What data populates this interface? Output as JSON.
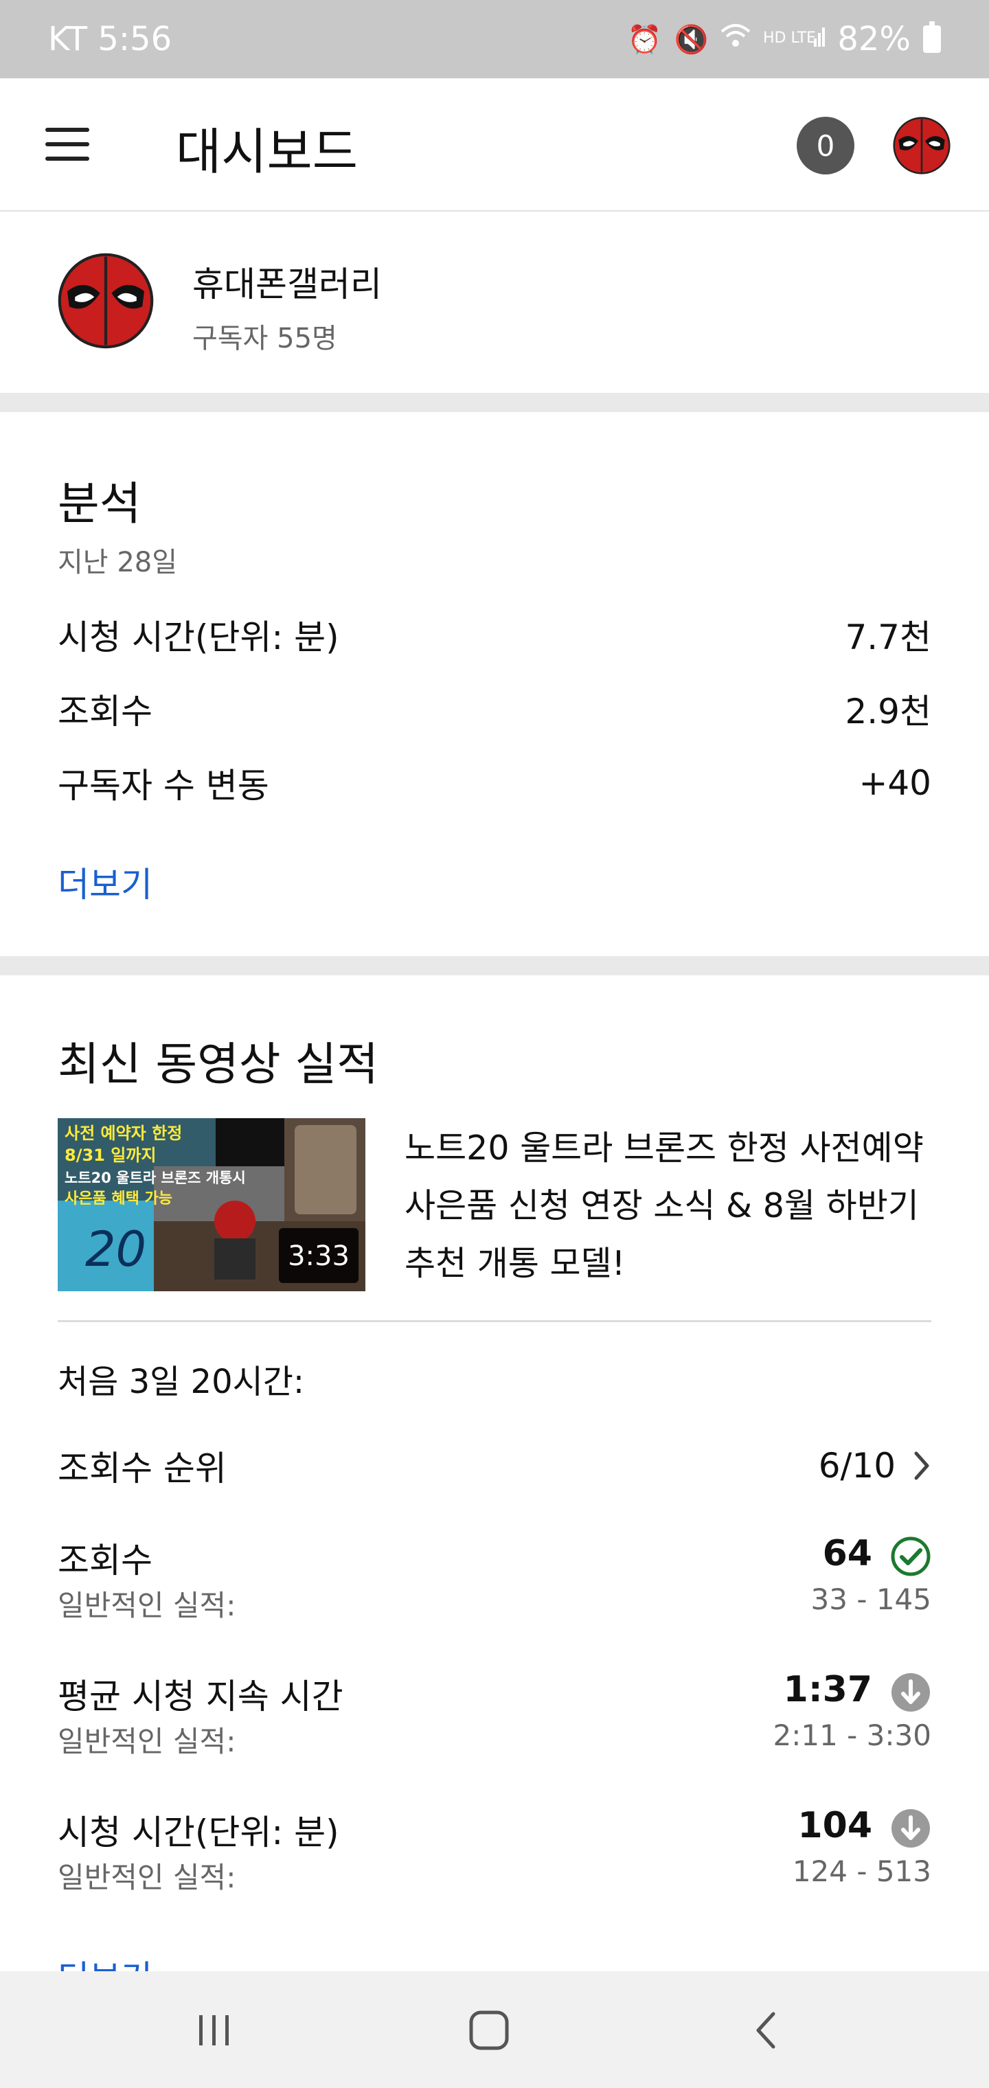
{
  "status_bar": {
    "carrier_time": "KT 5:56",
    "battery": "82%"
  },
  "app_bar": {
    "title": "대시보드",
    "notification_count": "0"
  },
  "channel": {
    "name": "휴대폰갤러리",
    "subscribers": "구독자 55명"
  },
  "analytics": {
    "title": "분석",
    "period": "지난 28일",
    "rows": [
      {
        "label": "시청 시간(단위: 분)",
        "value": "7.7천"
      },
      {
        "label": "조회수",
        "value": "2.9천"
      },
      {
        "label": "구독자 수 변동",
        "value": "+40"
      }
    ],
    "more": "더보기"
  },
  "latest_video": {
    "title": "최신 동영상 실적",
    "thumbnail": {
      "line1": "사전 예약자 한정",
      "line2": "8/31 일까지",
      "line3": "노트20 울트라 브론즈 개통시",
      "line4": "사은품 혜택 가능",
      "big_text": "20",
      "duration": "3:33"
    },
    "video_title": "노트20 울트라 브론즈 한정 사전예약 사은품 신청 연장 소식 & 8월 하반기 추천 개통 모델!",
    "period": "처음 3일 20시간:",
    "rank": {
      "label": "조회수 순위",
      "value": "6/10"
    },
    "metrics": [
      {
        "label": "조회수",
        "value": "64",
        "typical_label": "일반적인 실적:",
        "typical_range": "33 - 145",
        "status": "check-circle-icon"
      },
      {
        "label": "평균 시청 지속 시간",
        "value": "1:37",
        "typical_label": "일반적인 실적:",
        "typical_range": "2:11 - 3:30",
        "status": "arrow-down-circle-icon"
      },
      {
        "label": "시청 시간(단위: 분)",
        "value": "104",
        "typical_label": "일반적인 실적:",
        "typical_range": "124 - 513",
        "status": "arrow-down-circle-icon"
      }
    ],
    "more": "더보기"
  },
  "colors": {
    "accent_link": "#1a5fd0",
    "success": "#1b7a2e",
    "neutral_icon": "#9a9a9a"
  }
}
